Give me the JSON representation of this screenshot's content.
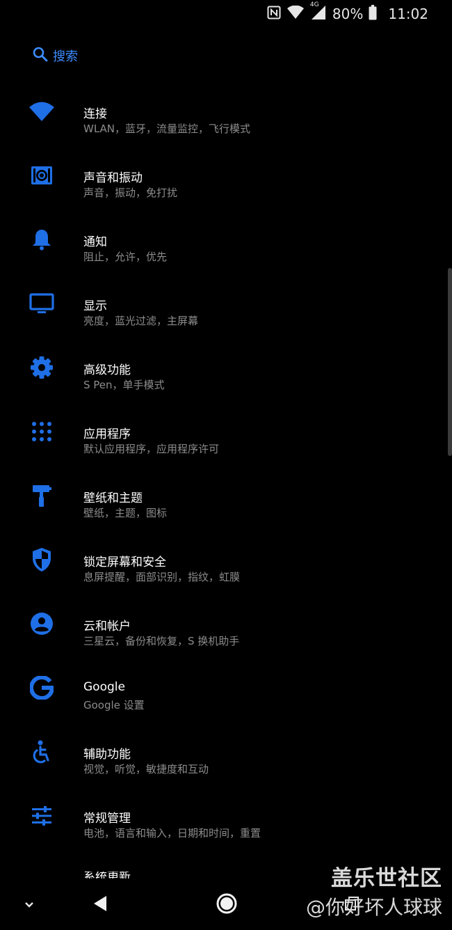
{
  "status": {
    "battery": "80%",
    "time": "11:02",
    "network": "4G"
  },
  "search": {
    "label": "搜索",
    "icon": "search-icon"
  },
  "accent": "#1f6fe6",
  "items": [
    {
      "title": "连接",
      "subtitle": "WLAN，蓝牙，流量监控，飞行模式",
      "icon": "wifi-icon"
    },
    {
      "title": "声音和振动",
      "subtitle": "声音，振动，免打扰",
      "icon": "speaker-icon"
    },
    {
      "title": "通知",
      "subtitle": "阻止，允许，优先",
      "icon": "bell-icon"
    },
    {
      "title": "显示",
      "subtitle": "亮度，蓝光过滤，主屏幕",
      "icon": "monitor-icon"
    },
    {
      "title": "高级功能",
      "subtitle": "S Pen，单手模式",
      "icon": "gear-icon"
    },
    {
      "title": "应用程序",
      "subtitle": "默认应用程序，应用程序许可",
      "icon": "apps-grid-icon"
    },
    {
      "title": "壁纸和主题",
      "subtitle": "壁纸，主题，图标",
      "icon": "paint-roller-icon"
    },
    {
      "title": "锁定屏幕和安全",
      "subtitle": "息屏提醒，面部识别，指纹，虹膜",
      "icon": "shield-icon"
    },
    {
      "title": "云和帐户",
      "subtitle": "三星云，备份和恢复，S 换机助手",
      "icon": "account-circle-icon"
    },
    {
      "title": "Google",
      "subtitle": "Google 设置",
      "icon": "google-icon"
    },
    {
      "title": "辅助功能",
      "subtitle": "视觉，听觉，敏捷度和互动",
      "icon": "accessibility-icon"
    },
    {
      "title": "常规管理",
      "subtitle": "电池，语言和输入，日期和时间，重置",
      "icon": "sliders-icon"
    }
  ],
  "partial_item": {
    "title": "系统更新"
  },
  "watermark": {
    "line1": "盖乐世社区",
    "line2": "@你好坏人球球"
  }
}
